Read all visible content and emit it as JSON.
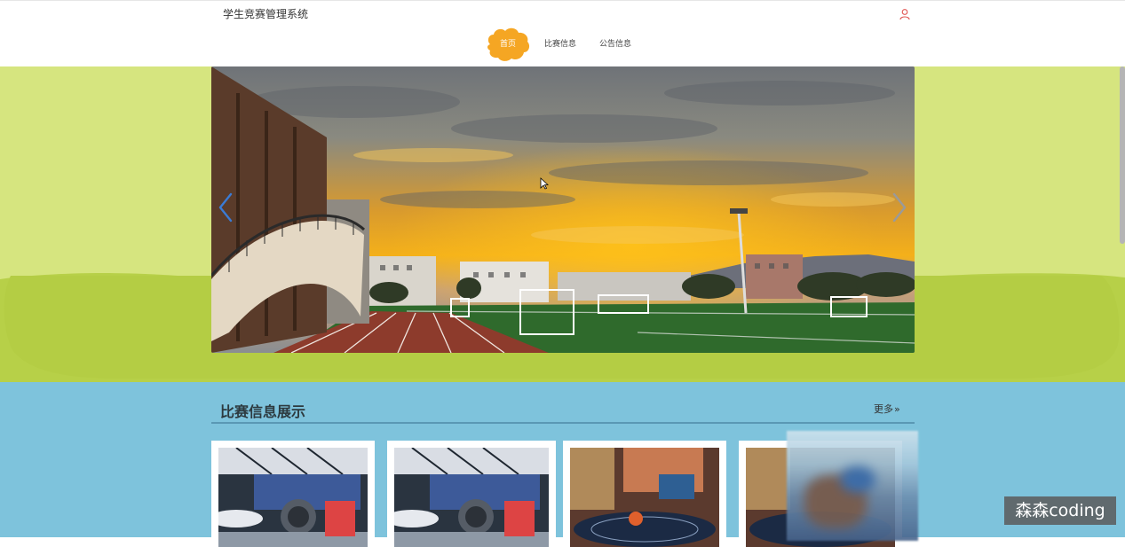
{
  "header": {
    "site_title": "学生竞赛管理系统",
    "user_icon": "user-icon",
    "nav": [
      {
        "label": "首页",
        "active": true
      },
      {
        "label": "比赛信息",
        "active": false
      },
      {
        "label": "公告信息",
        "active": false
      }
    ]
  },
  "carousel": {
    "prev_icon": "chevron-left-icon",
    "next_icon": "chevron-right-icon"
  },
  "section": {
    "title": "比赛信息展示",
    "more_label": "更多",
    "more_icon": "double-chevron-right-icon"
  },
  "watermark": "森森coding",
  "colors": {
    "hero_bg": "#d6e57f",
    "hero_grass": "#b7d048",
    "section_bg": "#7ec3dc",
    "nav_active": "#f5a623",
    "user_icon": "#e0534f"
  }
}
